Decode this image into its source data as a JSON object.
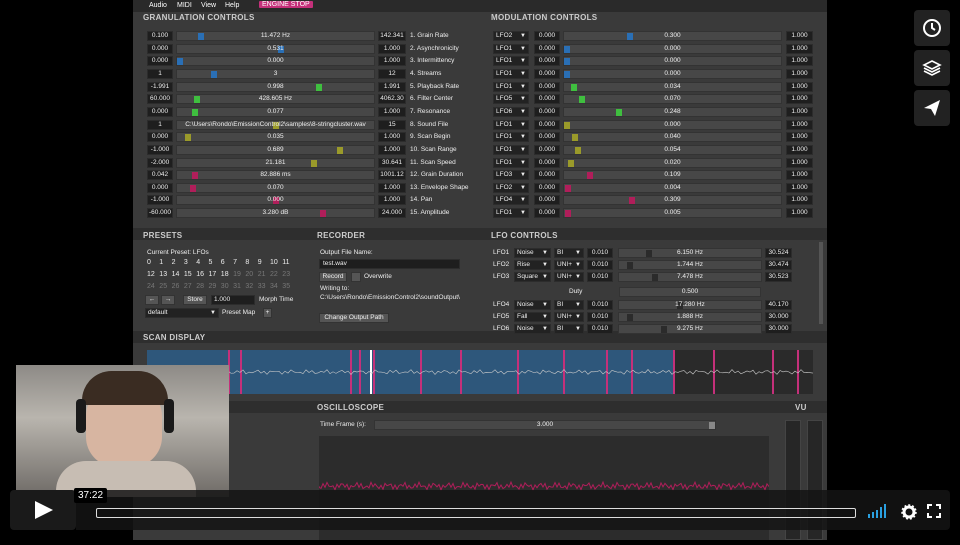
{
  "menu": {
    "items": [
      "Audio",
      "MIDI",
      "View",
      "Help"
    ],
    "engine_stop": "ENGINE STOP"
  },
  "sections": {
    "granulation": "GRANULATION CONTROLS",
    "modulation": "MODULATION CONTROLS",
    "presets": "PRESETS",
    "recorder": "RECORDER",
    "lfo": "LFO CONTROLS",
    "scan": "SCAN DISPLAY",
    "osc": "OSCILLOSCOPE",
    "vu": "VU"
  },
  "granulation": [
    {
      "min": "0.100",
      "value": "11.472 Hz",
      "max": "142.341",
      "label": "1. Grain Rate",
      "pos": 0.11,
      "color": "#2a6fb5"
    },
    {
      "min": "0.000",
      "value": "0.531",
      "max": "1.000",
      "label": "2. Asynchronicity",
      "pos": 0.53,
      "color": "#2a6fb5"
    },
    {
      "min": "0.000",
      "value": "0.000",
      "max": "1.000",
      "label": "3. Intermittency",
      "pos": 0.0,
      "color": "#2a6fb5"
    },
    {
      "min": "1",
      "value": "3",
      "max": "12",
      "label": "4. Streams",
      "pos": 0.18,
      "color": "#2a6fb5"
    },
    {
      "min": "-1.991",
      "value": "0.998",
      "max": "1.991",
      "label": "5. Playback Rate",
      "pos": 0.73,
      "color": "#3fbf3f"
    },
    {
      "min": "60.000",
      "value": "428.605 Hz",
      "max": "4062.30",
      "label": "6. Filter Center",
      "pos": 0.09,
      "color": "#3fbf3f"
    },
    {
      "min": "0.000",
      "value": "0.077",
      "max": "1.000",
      "label": "7. Resonance",
      "pos": 0.08,
      "color": "#3fbf3f"
    },
    {
      "min": "1",
      "value": "C:\\Users\\Rondo\\EmissionControl2\\samples\\8-stringcluster.wav",
      "max": "15",
      "label": "8. Sound File",
      "pos": 0.5,
      "color": "#9a9a2a"
    },
    {
      "min": "0.000",
      "value": "0.035",
      "max": "1.000",
      "label": "9. Scan Begin",
      "pos": 0.04,
      "color": "#9a9a2a"
    },
    {
      "min": "-1.000",
      "value": "0.689",
      "max": "1.000",
      "label": "10. Scan Range",
      "pos": 0.84,
      "color": "#9a9a2a"
    },
    {
      "min": "-2.000",
      "value": "21.181",
      "max": "30.641",
      "label": "11. Scan Speed",
      "pos": 0.7,
      "color": "#9a9a2a"
    },
    {
      "min": "0.042",
      "value": "82.886 ms",
      "max": "1001.12",
      "label": "12. Grain Duration",
      "pos": 0.08,
      "color": "#b01e5a"
    },
    {
      "min": "0.000",
      "value": "0.070",
      "max": "1.000",
      "label": "13. Envelope Shape",
      "pos": 0.07,
      "color": "#b01e5a"
    },
    {
      "min": "-1.000",
      "value": "0.000",
      "max": "1.000",
      "label": "14. Pan",
      "pos": 0.5,
      "color": "#b01e5a"
    },
    {
      "min": "-60.000",
      "value": "3.280 dB",
      "max": "24.000",
      "label": "15. Amplitude",
      "pos": 0.75,
      "color": "#b01e5a"
    }
  ],
  "modulation": [
    {
      "lfo": "LFO2",
      "min": "0.000",
      "value": "0.300",
      "max": "1.000",
      "pos": 0.3,
      "color": "#2a6fb5"
    },
    {
      "lfo": "LFO1",
      "min": "0.000",
      "value": "0.000",
      "max": "1.000",
      "pos": 0.0,
      "color": "#2a6fb5"
    },
    {
      "lfo": "LFO1",
      "min": "0.000",
      "value": "0.000",
      "max": "1.000",
      "pos": 0.0,
      "color": "#2a6fb5"
    },
    {
      "lfo": "LFO1",
      "min": "0.000",
      "value": "0.000",
      "max": "1.000",
      "pos": 0.0,
      "color": "#2a6fb5"
    },
    {
      "lfo": "LFO1",
      "min": "0.000",
      "value": "0.034",
      "max": "1.000",
      "pos": 0.034,
      "color": "#3fbf3f"
    },
    {
      "lfo": "LFO5",
      "min": "0.000",
      "value": "0.070",
      "max": "1.000",
      "pos": 0.07,
      "color": "#3fbf3f"
    },
    {
      "lfo": "LFO6",
      "min": "0.000",
      "value": "0.248",
      "max": "1.000",
      "pos": 0.248,
      "color": "#3fbf3f"
    },
    {
      "lfo": "LFO1",
      "min": "0.000",
      "value": "0.000",
      "max": "1.000",
      "pos": 0.0,
      "color": "#9a9a2a"
    },
    {
      "lfo": "LFO1",
      "min": "0.000",
      "value": "0.040",
      "max": "1.000",
      "pos": 0.04,
      "color": "#9a9a2a"
    },
    {
      "lfo": "LFO1",
      "min": "0.000",
      "value": "0.054",
      "max": "1.000",
      "pos": 0.054,
      "color": "#9a9a2a"
    },
    {
      "lfo": "LFO1",
      "min": "0.000",
      "value": "0.020",
      "max": "1.000",
      "pos": 0.02,
      "color": "#9a9a2a"
    },
    {
      "lfo": "LFO3",
      "min": "0.000",
      "value": "0.109",
      "max": "1.000",
      "pos": 0.109,
      "color": "#b01e5a"
    },
    {
      "lfo": "LFO2",
      "min": "0.000",
      "value": "0.004",
      "max": "1.000",
      "pos": 0.004,
      "color": "#b01e5a"
    },
    {
      "lfo": "LFO4",
      "min": "0.000",
      "value": "0.309",
      "max": "1.000",
      "pos": 0.309,
      "color": "#b01e5a"
    },
    {
      "lfo": "LFO1",
      "min": "0.000",
      "value": "0.005",
      "max": "1.000",
      "pos": 0.005,
      "color": "#b01e5a"
    }
  ],
  "presets": {
    "current": "Current Preset: LFOs",
    "numbers": [
      "0",
      "1",
      "2",
      "3",
      "4",
      "5",
      "6",
      "7",
      "8",
      "9",
      "10",
      "11",
      "12",
      "13",
      "14",
      "15",
      "16",
      "17",
      "18",
      "19",
      "20",
      "21",
      "22",
      "23",
      "24",
      "25",
      "26",
      "27",
      "28",
      "29",
      "30",
      "31",
      "32",
      "33",
      "34",
      "35"
    ],
    "store": "Store",
    "morph_value": "1.000",
    "morph_label": "Morph Time",
    "map_value": "default",
    "map_label": "Preset Map",
    "add": "+",
    "prev": "←",
    "next": "→"
  },
  "recorder": {
    "file_label": "Output File Name:",
    "file_value": "test.wav",
    "record": "Record",
    "overwrite": "Overwrite",
    "writing_to": "Writing to:",
    "path": "C:\\Users\\Rondo\\EmissionControl2\\soundOutput\\",
    "change": "Change Output Path"
  },
  "lfos": [
    {
      "name": "LFO1",
      "shape": "Noise",
      "polarity": "BI",
      "freq_min": "0.010",
      "freq": "6.150 Hz",
      "freq_max": "30.524",
      "pos": 0.2
    },
    {
      "name": "LFO2",
      "shape": "Rise",
      "polarity": "UNI+",
      "freq_min": "0.010",
      "freq": "1.744 Hz",
      "freq_max": "30.474",
      "pos": 0.06
    },
    {
      "name": "LFO3",
      "shape": "Square",
      "polarity": "UNI+",
      "freq_min": "0.010",
      "freq": "7.478 Hz",
      "freq_max": "30.523",
      "pos": 0.24
    },
    {
      "name": "LFO4",
      "shape": "Noise",
      "polarity": "BI",
      "freq_min": "0.010",
      "freq": "17.280 Hz",
      "freq_max": "40.170",
      "pos": 0.43
    },
    {
      "name": "LFO5",
      "shape": "Fall",
      "polarity": "UNI+",
      "freq_min": "0.010",
      "freq": "1.888 Hz",
      "freq_max": "30.000",
      "pos": 0.06
    },
    {
      "name": "LFO6",
      "shape": "Noise",
      "polarity": "BI",
      "freq_min": "0.010",
      "freq": "9.275 Hz",
      "freq_max": "30.000",
      "pos": 0.31
    }
  ],
  "duty": {
    "label": "Duty",
    "value": "0.500"
  },
  "oscilloscope": {
    "time_label": "Time Frame (s):",
    "time_value": "3.000"
  },
  "player": {
    "time": "37:22",
    "progress": 0.0
  },
  "colors": {
    "panel": "#3a3a3a",
    "accent": "#c4307a",
    "blue": "#2a6fb5"
  }
}
